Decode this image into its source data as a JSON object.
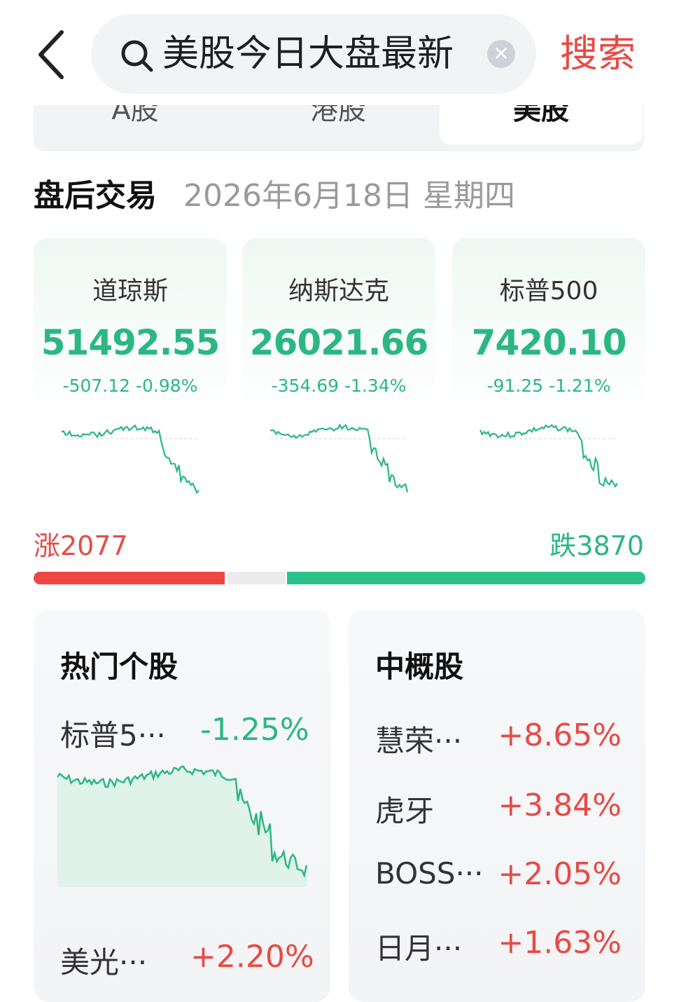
{
  "search": {
    "query": "美股今日大盘最新",
    "button_label": "搜索"
  },
  "tabs": [
    {
      "label": "A股"
    },
    {
      "label": "港股"
    },
    {
      "label": "美股",
      "active": true
    }
  ],
  "section": {
    "title": "盘后交易",
    "date": "2026年6月18日 星期四"
  },
  "indices": [
    {
      "name": "道琼斯",
      "value": "51492.55",
      "change": "-507.12",
      "change_pct": "-0.98%"
    },
    {
      "name": "纳斯达克",
      "value": "26021.66",
      "change": "-354.69",
      "change_pct": "-1.34%"
    },
    {
      "name": "标普500",
      "value": "7420.10",
      "change": "-91.25",
      "change_pct": "-1.21%"
    }
  ],
  "breadth": {
    "rise_label": "涨2077",
    "fall_label": "跌3870",
    "rise": 2077,
    "flat_share": 0.1,
    "fall": 3870
  },
  "hot_stocks": {
    "title": "热门个股",
    "items": [
      {
        "name": "标普5···",
        "change": "-1.25%"
      },
      {
        "name": "美光···",
        "change": "+2.20%"
      }
    ]
  },
  "china_concepts": {
    "title": "中概股",
    "items": [
      {
        "name": "慧荣···",
        "change": "+8.65%"
      },
      {
        "name": "虎牙",
        "change": "+3.84%"
      },
      {
        "name": "BOSS···",
        "change": "+2.05%"
      },
      {
        "name": "日月···",
        "change": "+1.63%"
      }
    ]
  },
  "colors": {
    "up": "#e84a45",
    "down": "#2bb783",
    "search_button": "#e84a45"
  },
  "icons": {
    "back": "chevron-left-icon",
    "search": "search-icon",
    "clear": "clear-icon"
  }
}
